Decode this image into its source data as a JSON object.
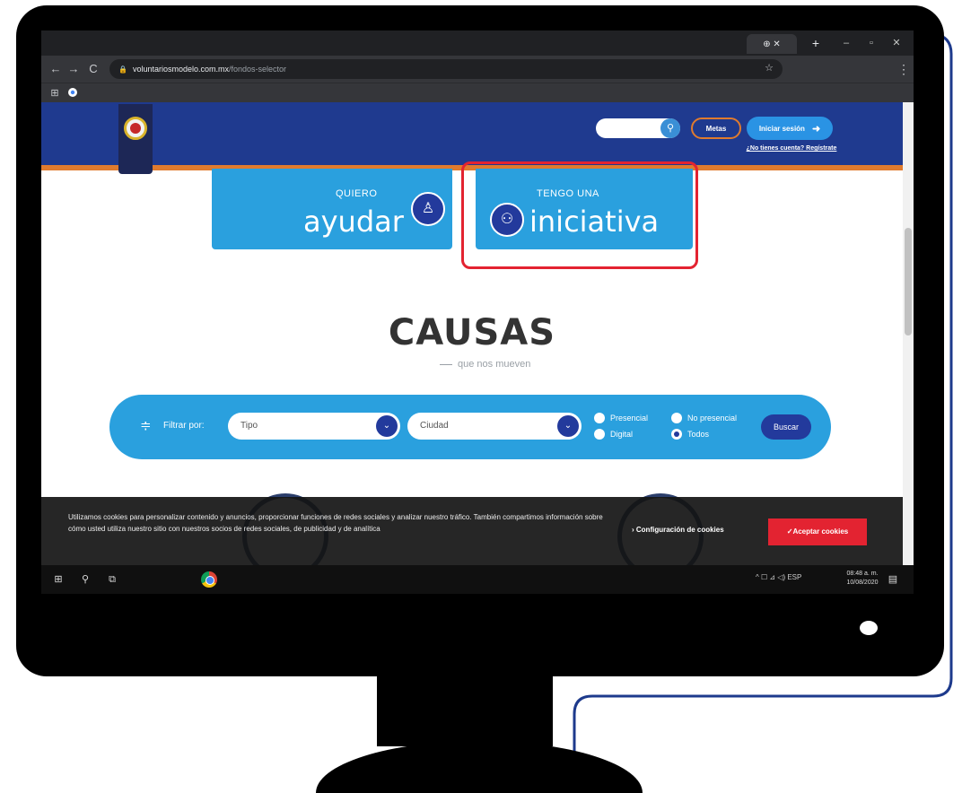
{
  "browser": {
    "tab_label": "⊕ ✕",
    "new_tab": "+",
    "minimize": "–",
    "restore": "▫",
    "close": "✕",
    "url_domain": "voluntariosmodelo.com.mx",
    "url_path": "/fondos-selector",
    "back": "←",
    "forward": "→",
    "reload": "C",
    "lock": "🔒",
    "star": "☆",
    "menu": "⋮",
    "apps": "⊞"
  },
  "site": {
    "metas_label": "Metas",
    "login_label": "Iniciar sesión",
    "login_icon": "➜",
    "signup_link": "¿No tienes cuenta? Regístrate",
    "search_icon": "⚲"
  },
  "hero": {
    "left_small": "QUIERO",
    "left_big": "ayudar",
    "left_icon": "♙",
    "right_small": "TENGO UNA",
    "right_big": "iniciativa",
    "right_icon": "⚇"
  },
  "causas": {
    "title": "CAUSAS",
    "subtitle": "que nos mueven"
  },
  "filter": {
    "label": "Filtrar por:",
    "icon": "≑",
    "tipo_value": "Tipo",
    "ciudad_value": "Ciudad",
    "arrow": "⌄",
    "opt_presencial": "Presencial",
    "opt_no_presencial": "No presencial",
    "opt_digital": "Digital",
    "opt_todos": "Todos",
    "search_button": "Buscar"
  },
  "cookies": {
    "text": "Utilizamos cookies para personalizar contenido y anuncios, proporcionar funciones de redes sociales y analizar nuestro tráfico. También compartimos información sobre cómo usted utiliza nuestro sitio con nuestros socios de redes sociales, de publicidad y de analítica",
    "config_link": "› Configuración de cookies",
    "accept_button": "✓Aceptar cookies"
  },
  "taskbar": {
    "start": "⊞",
    "search": "⚲",
    "task_view": "⧉",
    "tray": "^  ☐  ⊿  ◁)  ESP",
    "time": "08:48 a. m.",
    "date": "10/08/2020",
    "notify": "▤"
  }
}
